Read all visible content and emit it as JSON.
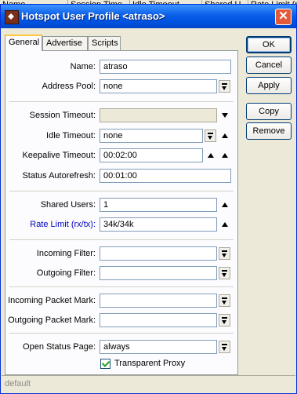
{
  "background_header": {
    "columns": [
      "Name",
      "Session Time...",
      "Idle Timeout",
      "Shared U...",
      "Rate Limit (rx..."
    ]
  },
  "window": {
    "title": "Hotspot User Profile <atraso>",
    "close_label": "✕"
  },
  "tabs": [
    {
      "label": "General",
      "active": true
    },
    {
      "label": "Advertise",
      "active": false
    },
    {
      "label": "Scripts",
      "active": false
    }
  ],
  "form": {
    "name": {
      "label": "Name:",
      "value": "atraso"
    },
    "address_pool": {
      "label": "Address Pool:",
      "value": "none"
    },
    "session_timeout": {
      "label": "Session Timeout:",
      "value": ""
    },
    "idle_timeout": {
      "label": "Idle Timeout:",
      "value": "none"
    },
    "keepalive_timeout": {
      "label": "Keepalive Timeout:",
      "value": "00:02:00"
    },
    "status_autorefresh": {
      "label": "Status Autorefresh:",
      "value": "00:01:00"
    },
    "shared_users": {
      "label": "Shared Users:",
      "value": "1"
    },
    "rate_limit": {
      "label": "Rate Limit (rx/tx):",
      "value": "34k/34k"
    },
    "incoming_filter": {
      "label": "Incoming Filter:",
      "value": ""
    },
    "outgoing_filter": {
      "label": "Outgoing Filter:",
      "value": ""
    },
    "incoming_packet_mark": {
      "label": "Incoming Packet Mark:",
      "value": ""
    },
    "outgoing_packet_mark": {
      "label": "Outgoing Packet Mark:",
      "value": ""
    },
    "open_status_page": {
      "label": "Open Status Page:",
      "value": "always"
    },
    "transparent_proxy": {
      "label": "Transparent Proxy",
      "checked": true
    }
  },
  "buttons": {
    "ok": "OK",
    "cancel": "Cancel",
    "apply": "Apply",
    "copy": "Copy",
    "remove": "Remove"
  },
  "status_bar": {
    "text": "default"
  },
  "colors": {
    "titlebar": "#0054e3",
    "accent_label": "#0000c0",
    "window_bg": "#ece9d8"
  }
}
